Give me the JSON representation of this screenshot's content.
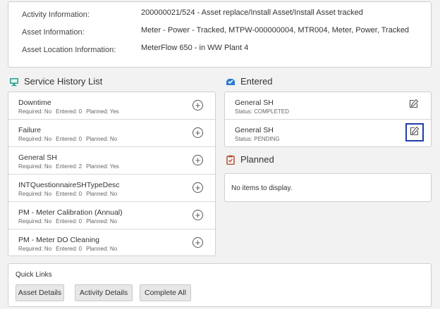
{
  "info": {
    "activity_label": "Activity Information:",
    "activity_value": "200000021/524 - Asset replace/Install Asset/Install Asset tracked",
    "asset_label": "Asset Information:",
    "asset_value": "Meter - Power - Tracked, MTPW-000000004, MTR004, Meter, Power, Tracked",
    "location_label": "Asset Location Information:",
    "location_value": "MeterFlow 650 - in WW Plant 4"
  },
  "service_history": {
    "title": "Service History List",
    "icon": "monitor-icon",
    "items": [
      {
        "title": "Downtime",
        "required": "Required: No",
        "entered": "Entered: 0",
        "planned": "Planned: Yes"
      },
      {
        "title": "Failure",
        "required": "Required: No",
        "entered": "Entered: 0",
        "planned": "Planned: No"
      },
      {
        "title": "General SH",
        "required": "Required: No",
        "entered": "Entered: 2",
        "planned": "Planned: Yes"
      },
      {
        "title": "INTQuestionnaireSHTypeDesc",
        "required": "Required: No",
        "entered": "Entered: 0",
        "planned": "Planned: No"
      },
      {
        "title": "PM - Meter Calibration (Annual)",
        "required": "Required: No",
        "entered": "Entered: 0",
        "planned": "Planned: No"
      },
      {
        "title": "PM - Meter DO Cleaning",
        "required": "Required: No",
        "entered": "Entered: 0",
        "planned": "Planned: No"
      }
    ]
  },
  "entered": {
    "title": "Entered",
    "icon": "inbox-check-icon",
    "items": [
      {
        "title": "General SH",
        "status": "Status: COMPLETED"
      },
      {
        "title": "General SH",
        "status": "Status: PENDING"
      }
    ]
  },
  "planned": {
    "title": "Planned",
    "icon": "clipboard-icon",
    "empty_text": "No items to display."
  },
  "quick_links": {
    "title": "Quick Links",
    "buttons": [
      "Asset Details",
      "Activity Details",
      "Complete All"
    ]
  },
  "colors": {
    "monitor_icon": "#2a9d8f",
    "entered_icon": "#2b7bd1",
    "planned_icon": "#b5442a",
    "highlight_border": "#1f3da7"
  }
}
